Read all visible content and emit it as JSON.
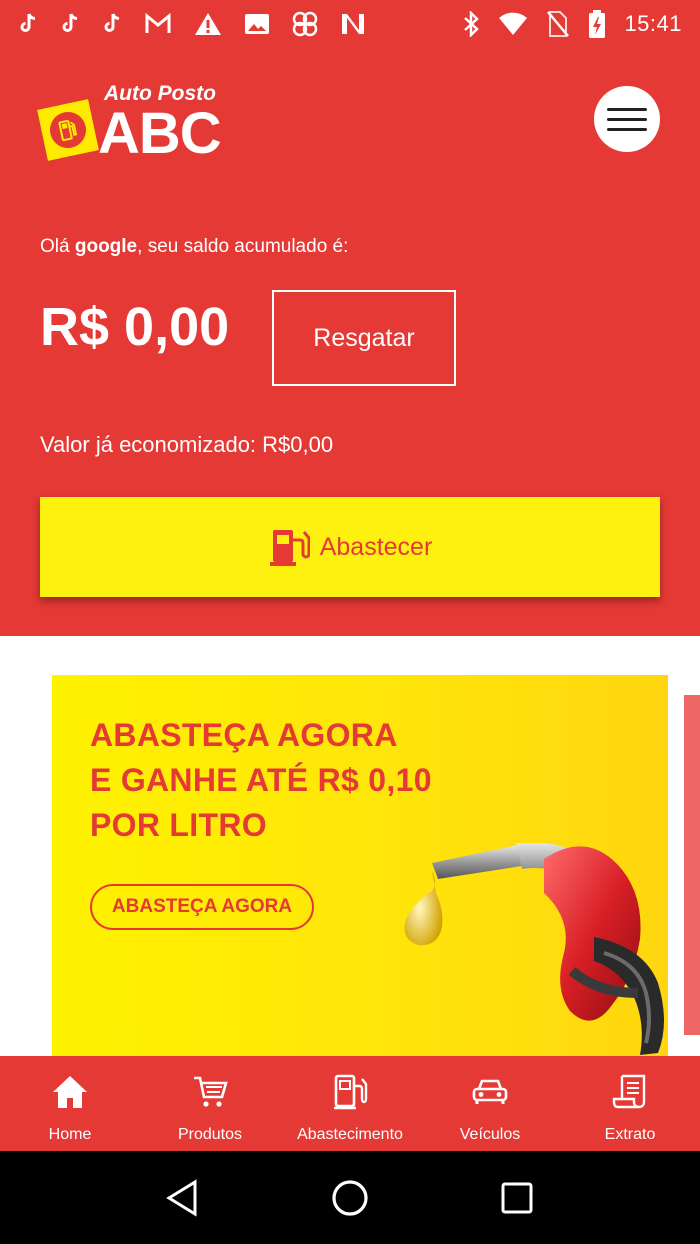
{
  "status_bar": {
    "time": "15:41",
    "left_icons": [
      "tiktok-icon",
      "tiktok-icon",
      "tiktok-icon",
      "gmail-icon",
      "warning-icon",
      "image-icon",
      "pinwheel-icon",
      "n-app-icon"
    ],
    "right_icons": [
      "bluetooth-icon",
      "wifi-icon",
      "no-sim-icon",
      "battery-charging-icon"
    ]
  },
  "header": {
    "logo_sub": "Auto Posto",
    "logo_main": "ABC",
    "greeting_prefix": "Olá ",
    "user_name": "google",
    "greeting_suffix": ", seu saldo acumulado é:",
    "balance": "R$ 0,00",
    "redeem_label": "Resgatar",
    "saved_text": "Valor já economizado: R$0,00",
    "refuel_label": "Abastecer"
  },
  "banner": {
    "line1": "ABASTEÇA AGORA",
    "line2": "E GANHE ATÉ R$ 0,10",
    "line3": "POR LITRO",
    "cta": "ABASTEÇA AGORA"
  },
  "bottom_nav": {
    "items": [
      {
        "label": "Home",
        "icon": "home-icon"
      },
      {
        "label": "Produtos",
        "icon": "cart-icon"
      },
      {
        "label": "Abastecimento",
        "icon": "fuel-pump-icon"
      },
      {
        "label": "Veículos",
        "icon": "car-icon"
      },
      {
        "label": "Extrato",
        "icon": "receipt-icon"
      }
    ]
  },
  "colors": {
    "primary": "#e53935",
    "accent": "#fff10f",
    "text_light": "#ffffff"
  }
}
